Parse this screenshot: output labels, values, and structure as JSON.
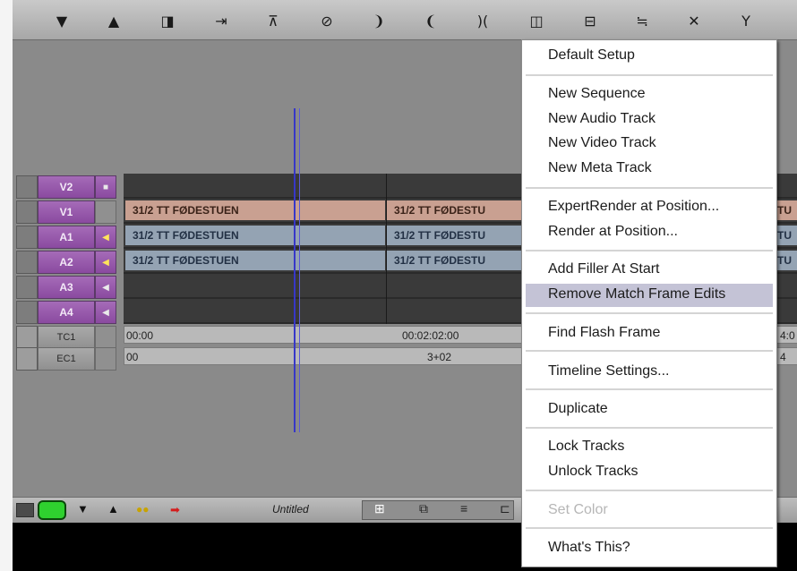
{
  "colors": {
    "track_purple": "#9b5cae",
    "video_clip": "#c9a091",
    "audio_clip": "#94a3b3",
    "playhead": "#3737c8",
    "menu_highlight": "#c4c3d6",
    "monitor_green": "#2fd12f"
  },
  "toolbar": {
    "icons": [
      "arrow-down-icon",
      "arrow-up-icon",
      "mark-clip-icon",
      "replace-edit-icon",
      "overwrite-icon",
      "no-entry-icon",
      "moon-right-icon",
      "moon-left-icon",
      "ripple-trim-icon",
      "split-icon",
      "lift-icon",
      "extract-icon",
      "close-x-icon",
      "filter-icon"
    ]
  },
  "tracks": [
    {
      "name": "V2",
      "indicator": "■"
    },
    {
      "name": "V1",
      "indicator": ""
    },
    {
      "name": "A1",
      "indicator": "◀"
    },
    {
      "name": "A2",
      "indicator": "◀"
    },
    {
      "name": "A3",
      "indicator": "◀"
    },
    {
      "name": "A4",
      "indicator": "◀"
    }
  ],
  "clips": {
    "v1": [
      "31/2 TT FØDESTUEN",
      "31/2 TT FØDESTU",
      "TU"
    ],
    "a1": [
      "31/2 TT FØDESTUEN",
      "31/2 TT FØDESTU",
      "TU"
    ],
    "a2": [
      "31/2 TT FØDESTUEN",
      "31/2 TT FØDESTU",
      "TU"
    ]
  },
  "rulers": {
    "tc1": {
      "label": "TC1",
      "start": "00:00",
      "mid": "00:02:02:00",
      "end": "4:0"
    },
    "ec1": {
      "label": "EC1",
      "start": "00",
      "mid": "3+02",
      "end": "4"
    }
  },
  "bottom_bar": {
    "sequence_name": "Untitled"
  },
  "context_menu": {
    "items": {
      "default_setup": "Default Setup",
      "new_sequence": "New Sequence",
      "new_audio_track": "New Audio Track",
      "new_video_track": "New Video Track",
      "new_meta_track": "New Meta Track",
      "expertrender": "ExpertRender at Position...",
      "render_at_position": "Render at Position...",
      "add_filler": "Add Filler At Start",
      "remove_match_frame": "Remove Match Frame Edits",
      "find_flash_frame": "Find Flash Frame",
      "timeline_settings": "Timeline Settings...",
      "duplicate": "Duplicate",
      "lock_tracks": "Lock Tracks",
      "unlock_tracks": "Unlock Tracks",
      "set_color": "Set Color",
      "whats_this": "What's This?"
    },
    "highlighted": "Remove Match Frame Edits",
    "disabled": [
      "Set Color"
    ]
  }
}
